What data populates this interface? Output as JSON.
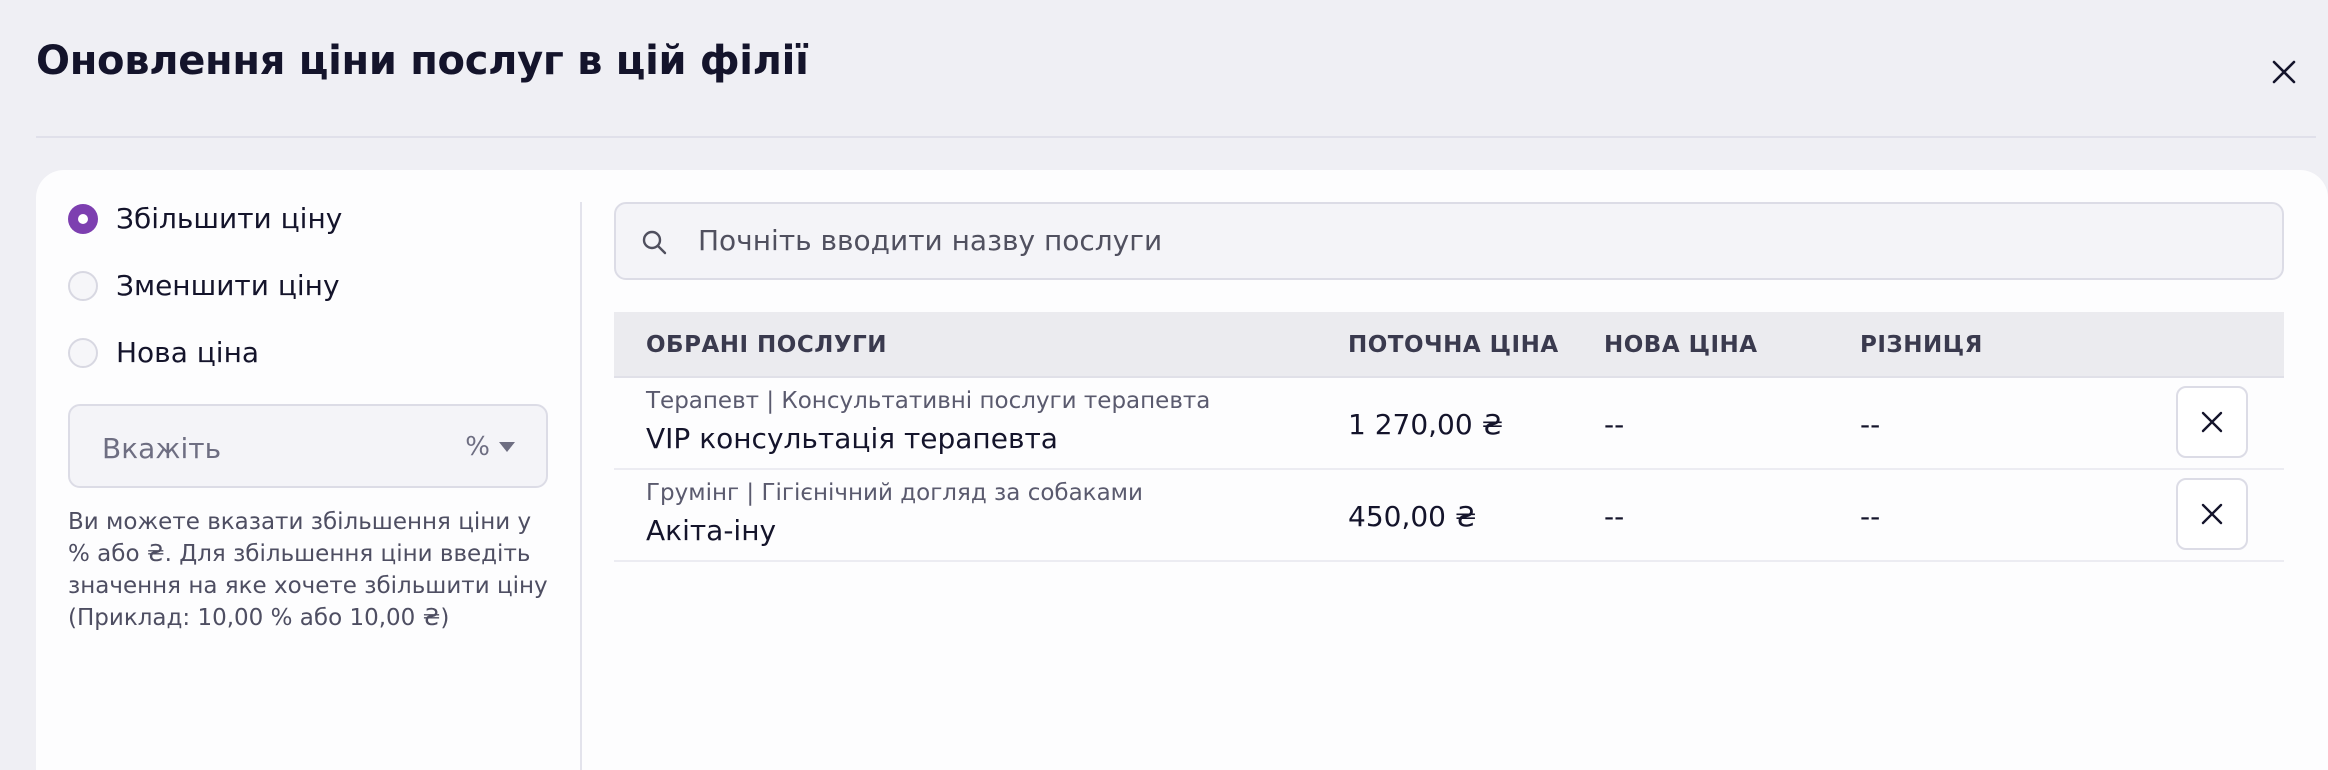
{
  "modal": {
    "title": "Оновлення ціни послуг в цій філії",
    "close_icon": "close-icon"
  },
  "options": [
    {
      "label": "Збільшити ціну",
      "checked": true
    },
    {
      "label": "Зменшити ціну",
      "checked": false
    },
    {
      "label": "Нова ціна",
      "checked": false
    }
  ],
  "value_input": {
    "placeholder": "Вкажіть",
    "unit": "%"
  },
  "hint": "Ви можете вказати збільшення ціни у % або ₴. Для збільшення ціни введіть значення на яке хочете збільшити ціну (Приклад: 10,00 % або 10,00 ₴)",
  "search": {
    "placeholder": "Почніть вводити назву послуги",
    "icon": "search-icon"
  },
  "table": {
    "headers": [
      "ОБРАНІ ПОСЛУГИ",
      "ПОТОЧНА ЦІНА",
      "НОВА ЦІНА",
      "РІЗНИЦЯ"
    ],
    "rows": [
      {
        "category": "Терапевт | Консультативні послуги терапевта",
        "name": "VIP консультація терапевта",
        "current_price": "1 270,00 ₴",
        "new_price": "--",
        "difference": "--"
      },
      {
        "category": "Грумінг | Гігієнічний догляд за собаками",
        "name": "Акіта-іну",
        "current_price": "450,00 ₴",
        "new_price": "--",
        "difference": "--"
      }
    ]
  },
  "colors": {
    "accent": "#7d3fb0",
    "background": "#efeff4",
    "panel": "#fdfdfe"
  }
}
